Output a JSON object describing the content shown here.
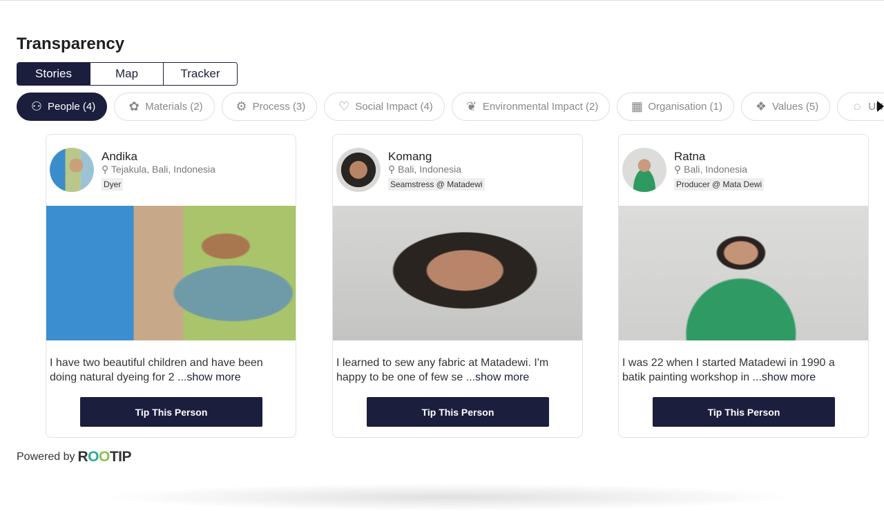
{
  "title": "Transparency",
  "tabs": [
    {
      "label": "Stories",
      "active": true
    },
    {
      "label": "Map"
    },
    {
      "label": "Tracker"
    }
  ],
  "chips": [
    {
      "label": "People (4)",
      "icon": "people-icon",
      "active": true
    },
    {
      "label": "Materials (2)",
      "icon": "plant-icon"
    },
    {
      "label": "Process (3)",
      "icon": "process-icon"
    },
    {
      "label": "Social Impact (4)",
      "icon": "heart-hand-icon"
    },
    {
      "label": "Environmental Impact (2)",
      "icon": "sprout-hand-icon"
    },
    {
      "label": "Organisation (1)",
      "icon": "storefront-icon"
    },
    {
      "label": "Values (5)",
      "icon": "hands-icon"
    },
    {
      "label": "UN",
      "icon": "sdg-wheel-icon"
    }
  ],
  "cards": [
    {
      "name": "Andika",
      "location": "Tejakula, Bali, Indonesia",
      "role": "Dyer",
      "text": "I have two beautiful children and have been doing natural dyeing for 2 ...",
      "more": "show more",
      "button": "Tip This Person"
    },
    {
      "name": "Komang",
      "location": "Bali, Indonesia",
      "role": "Seamstress @ Matadewi",
      "text": "I learned to sew any fabric at Matadewi. I'm happy to be one of few se ...",
      "more": "show more",
      "button": "Tip This Person"
    },
    {
      "name": "Ratna",
      "location": "Bali, Indonesia",
      "role": "Producer @ Mata Dewi",
      "text": "I was 22 when I started Matadewi in 1990 a batik painting workshop in  ...",
      "more": "show more",
      "button": "Tip This Person"
    }
  ],
  "footer": {
    "powered": "Powered by",
    "logo": "ROOTIP"
  },
  "colors": {
    "primary": "#1b1e3d"
  }
}
